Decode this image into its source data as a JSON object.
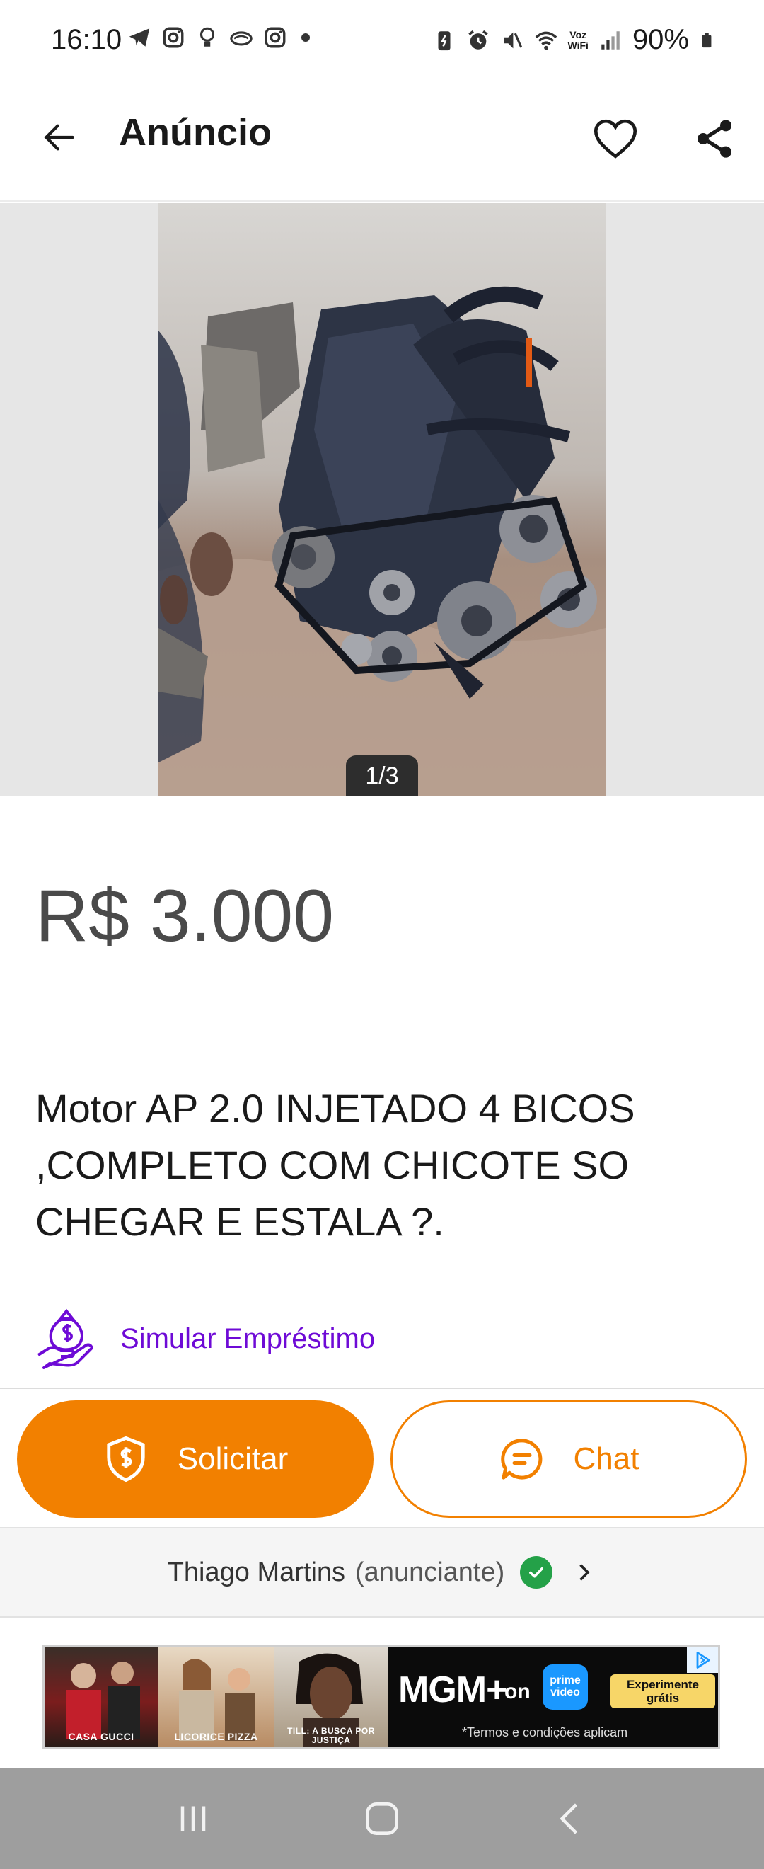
{
  "status_bar": {
    "time": "16:10",
    "battery": "90%",
    "voz_label": "Voz",
    "wifi_label": "WiFi"
  },
  "app_bar": {
    "title": "Anúncio"
  },
  "gallery": {
    "counter": "1/3"
  },
  "listing": {
    "price": "R$ 3.000",
    "title": "Motor AP 2.0 INJETADO 4 BICOS ,COMPLETO COM CHICOTE SO CHEGAR E ESTALA ?."
  },
  "loan": {
    "label": "Simular Empréstimo"
  },
  "actions": {
    "solicitar_label": "Solicitar",
    "chat_label": "Chat"
  },
  "seller": {
    "name": "Thiago Martins",
    "role": "(anunciante)"
  },
  "ad": {
    "poster1": "CASA GUCCI",
    "poster2": "LICORICE PIZZA",
    "poster3": "TILL: A BUSCA POR JUSTIÇA",
    "brand": "MGM+",
    "on": "on",
    "prime": "prime video",
    "cta": "Experimente grátis",
    "terms": "*Termos e condições aplicam"
  },
  "colors": {
    "accent": "#f28000",
    "purple": "#6e0ad6",
    "verified": "#24a148"
  }
}
